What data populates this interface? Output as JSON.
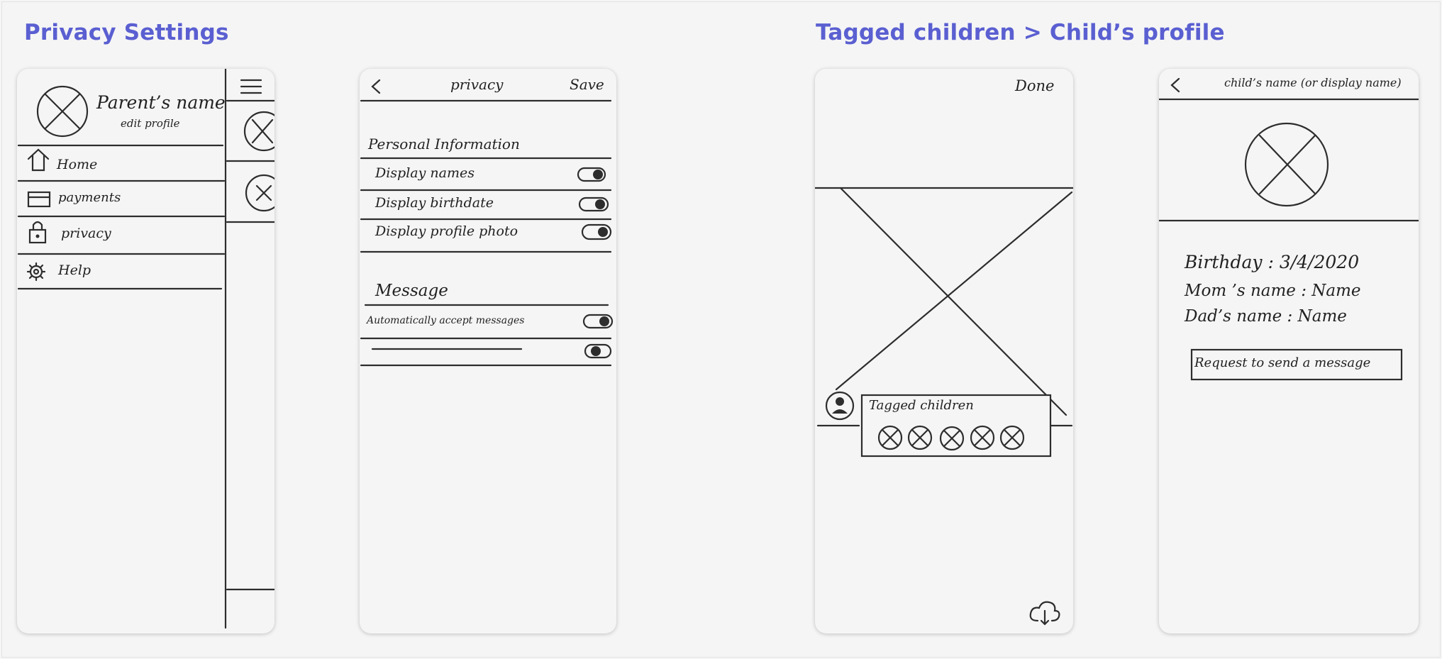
{
  "sections": {
    "privacy_title": "Privacy Settings",
    "tagged_title": "Tagged children > Child’s profile"
  },
  "menu_screen": {
    "parent_name": "Parent’s name",
    "edit_profile": "edit profile",
    "items": [
      {
        "label": "Home",
        "icon": "home-icon"
      },
      {
        "label": "payments",
        "icon": "card-icon"
      },
      {
        "label": "privacy",
        "icon": "lock-icon"
      },
      {
        "label": "Help",
        "icon": "gear-icon"
      }
    ]
  },
  "privacy_screen": {
    "title": "privacy",
    "save": "Save",
    "personal_heading": "Personal Information",
    "personal_toggles": [
      {
        "label": "Display names",
        "on": true
      },
      {
        "label": "Display birthdate",
        "on": true
      },
      {
        "label": "Display profile photo",
        "on": true
      }
    ],
    "message_heading": "Message",
    "message_toggles": [
      {
        "label": "Automatically accept messages",
        "on": true
      },
      {
        "label": "",
        "on": true
      }
    ]
  },
  "tagged_screen": {
    "done": "Done",
    "tagged_label": "Tagged children",
    "tagged_count": 5
  },
  "child_screen": {
    "title": "child’s name (or display name)",
    "birthday": "Birthday : 3/4/2020",
    "mom": "Mom ’s name : Name",
    "dad": "Dad’s name : Name",
    "request_button": "Request to send a message"
  },
  "colors": {
    "accent": "#5a5fd1",
    "stroke": "#2d2d2d",
    "background": "#f5f5f5"
  }
}
